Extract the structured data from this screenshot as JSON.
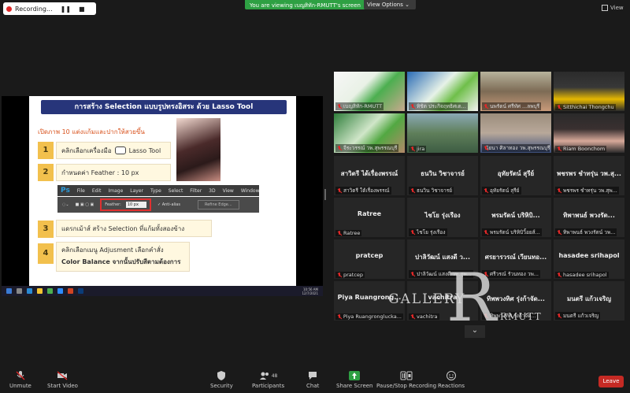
{
  "topbar": {
    "recording": "Recording...",
    "pause_glyph": "❚❚",
    "stop_glyph": "■",
    "viewing_text": "You are viewing เบญสิทัก-RMUTT's screen",
    "view_options": "View Options ⌄",
    "view_label": "View"
  },
  "slide": {
    "title": "การสร้าง Selection แบบรูปทรงอิสระ ด้วย Lasso Tool",
    "subtitle": "เปิดภาพ 10 แต่งแก้มและปากให้สวยขึ้น",
    "steps": [
      {
        "num": "1",
        "text": "คลิกเลือกเครื่องมือ",
        "tool": "Lasso Tool"
      },
      {
        "num": "2",
        "text": "กำหนดค่า Feather : 10 px"
      },
      {
        "num": "3",
        "text": "แดรกเม้าส์ สร้าง Selection ที่แก้มทั้งสองข้าง"
      },
      {
        "num": "4",
        "text": "คลิกเลือกเมนู Adjusment เลือกคำสั่ง",
        "text2": "Color Balance จากนั้นปรับสีตามต้องการ"
      }
    ],
    "ps_menu": [
      "Ps",
      "File",
      "Edit",
      "Image",
      "Layer",
      "Type",
      "Select",
      "Filter",
      "3D",
      "View",
      "Window"
    ],
    "ps_options": {
      "feather_label": "Feather:",
      "feather_value": "10 px",
      "anti_alias": "✓ Anti-alias",
      "refine": "Refine Edge..."
    }
  },
  "taskbar": {
    "time": "10:56 AM",
    "date": "12/7/2021"
  },
  "participants": [
    {
      "label": "เบญสิทัก-RMUTT",
      "name": ""
    },
    {
      "label": "ทิชิต ประกิจฤทธิศเต...",
      "name": ""
    },
    {
      "label": "นพรัตน์ ศรีทัศ ...ลพบุรี",
      "name": ""
    },
    {
      "label": "Sitthichai Thongchu",
      "name": ""
    },
    {
      "label": "จีระวรรณ์ วพ.สุพรรณบุรี",
      "name": ""
    },
    {
      "label": "jira",
      "name": ""
    },
    {
      "label": "นัยนา ศิลาทอง วพ.สุพรรณบุรี",
      "name": ""
    },
    {
      "label": "Riam Boonchom",
      "name": ""
    },
    {
      "label": "สาวิตรี ใต้เรื่องพรรณ์",
      "name": "สาวิตรี ได้เรื่องพรรณ์"
    },
    {
      "label": "ธนวิน วิชาจารย์",
      "name": "ธนวิน วิชาจารย์"
    },
    {
      "label": "อุทัยรัตน์ สุรีย์",
      "name": "อุทัยรัตน์ สุรีย์"
    },
    {
      "label": "พชรพร ชำทรุ่น วพ.สุพ...",
      "name": "พชรพร ชำทรุ่น วพ.สุ..."
    },
    {
      "label": "Ratree",
      "name": "Ratree"
    },
    {
      "label": "ไชโย รุ่งเรือง",
      "name": "ไชโย รุ่งเรือง"
    },
    {
      "label": "พรมรัตน์ บริหิบิวิ้อยส์...",
      "name": "พรมรัตน์ บริหิบิ..."
    },
    {
      "label": "ทิพาพนธ์ พวงรัตน์ วพ...",
      "name": "ทิพาพนธ์ พวงรัต..."
    },
    {
      "label": "pratcep",
      "name": "pratcep"
    },
    {
      "label": "ปาลิวัฒน์ แสงดี วพ.สุพ...",
      "name": "ปาลิวัฒน์ แสงดี ว..."
    },
    {
      "label": "ศรีวรณ์ รัวนทอง วพ...",
      "name": "ศรยารวรณ์ เวียนทอ..."
    },
    {
      "label": "hasadee srihapol",
      "name": "hasadee srihapol"
    },
    {
      "label": "Piya Ruangronglucka...",
      "name": "Piya Ruangrong..."
    },
    {
      "label": "vachitra",
      "name": "vachitra"
    },
    {
      "label": "ทิพพวงทิศ รุ่งกำจัด...",
      "name": "ทิพพวงทิศ รุ่งก้าจัด..."
    },
    {
      "label": "มนตรี แก้วเจริญ",
      "name": "มนตรี แก้วเจริญ"
    }
  ],
  "gallery_more": "⌄",
  "watermark": {
    "letter": "R",
    "gallery": "GALLERY",
    "rmutt": "RMUTT"
  },
  "toolbar": {
    "unmute": "Unmute",
    "start_video": "Start Video",
    "security": "Security",
    "participants": "Participants",
    "participants_count": "48",
    "chat": "Chat",
    "share_screen": "Share Screen",
    "pause_recording": "Pause/Stop Recording",
    "reactions": "Reactions",
    "leave": "Leave"
  },
  "colors": {
    "accent_green": "#2ea043",
    "leave_red": "#c52a24",
    "slide_title_bg": "#27357a",
    "step_num": "#f2c04d"
  }
}
